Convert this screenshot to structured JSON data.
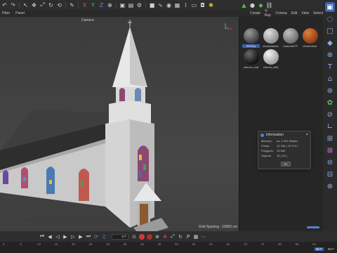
{
  "menus": {
    "viewport": [
      "Filter",
      "Panel"
    ],
    "material": [
      "Create",
      "V-Ray",
      "Corona",
      "Edit",
      "View",
      "Select"
    ]
  },
  "viewport": {
    "camera_label": "Camera",
    "grid_spacing": "Grid Spacing : 10000 cm"
  },
  "materials": [
    {
      "name": "ZSTrDy",
      "color_a": "#3c3c3c",
      "color_b": "#9a9a9a",
      "selected": true
    },
    {
      "name": "churchwindo",
      "color_a": "#8a8a8a",
      "color_b": "#e0e0e0",
      "selected": false
    },
    {
      "name": "ConcreteTF",
      "color_a": "#6a6a6a",
      "color_b": "#c0c0c0",
      "selected": false
    },
    {
      "name": "churchdoor",
      "color_a": "#8a3a10",
      "color_b": "#e08040",
      "selected": false
    },
    {
      "name": "church_roof",
      "color_a": "#0e0e0e",
      "color_b": "#6a6a6a",
      "selected": false
    },
    {
      "name": "church_whit",
      "color_a": "#9a9a9a",
      "color_b": "#f5f5f5",
      "selected": false
    }
  ],
  "info_dialog": {
    "title": "Information",
    "rows": [
      {
        "key": "Memory:",
        "value": "ca. 1 000 KBytes"
      },
      {
        "key": "Points:",
        "value": "16 396 ( 16 374 )"
      },
      {
        "key": "Polygons:",
        "value": "15 989"
      },
      {
        "key": "Objects:",
        "value": "18 ( 33 )"
      }
    ],
    "ok_label": "OK"
  },
  "timeline": {
    "current_frame": "0 F",
    "ticks": [
      "0",
      "5",
      "10",
      "15",
      "20",
      "25",
      "30",
      "35",
      "40",
      "45",
      "50",
      "55",
      "60",
      "65",
      "70",
      "75",
      "80",
      "85",
      "90"
    ],
    "end_frame": "90 F",
    "end_frame_b": "90 F"
  },
  "colors": {
    "accent": "#3a5fb0",
    "record": "#d03a3a"
  }
}
